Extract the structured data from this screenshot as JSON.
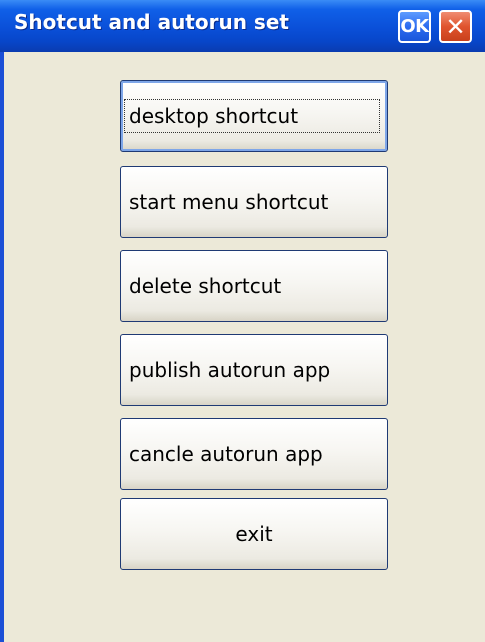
{
  "window": {
    "title": "Shotcut and autorun set",
    "ok_label": "OK",
    "close_label": "✕"
  },
  "buttons": [
    {
      "label": "desktop shortcut"
    },
    {
      "label": "start menu shortcut"
    },
    {
      "label": "delete shortcut"
    },
    {
      "label": "publish autorun app"
    },
    {
      "label": "cancle autorun app"
    },
    {
      "label": "exit"
    }
  ],
  "colors": {
    "titlebar": "#0A4FD8",
    "background": "#ECE9D8",
    "close_button": "#E0542E",
    "button_border": "#1F3A74"
  }
}
